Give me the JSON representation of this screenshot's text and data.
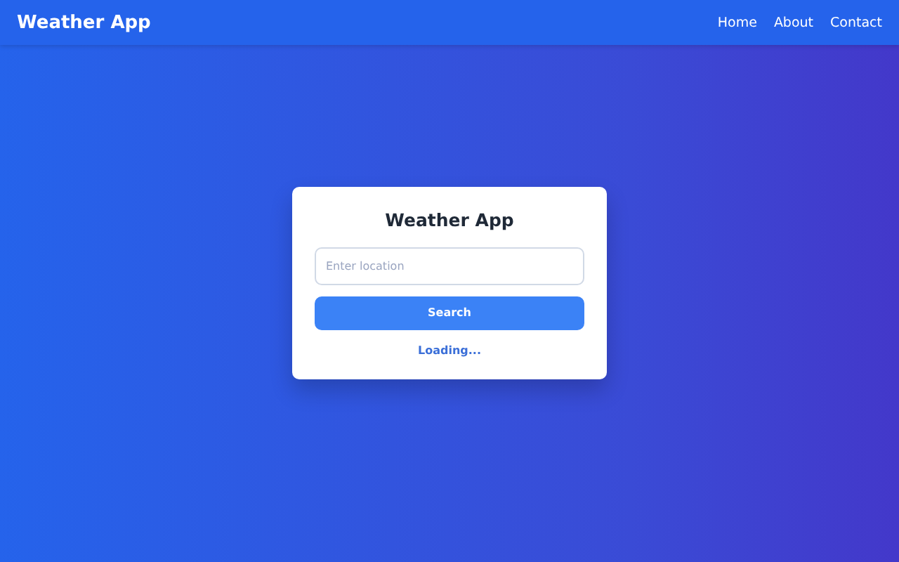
{
  "navbar": {
    "brand": "Weather App",
    "links": [
      {
        "label": "Home"
      },
      {
        "label": "About"
      },
      {
        "label": "Contact"
      }
    ]
  },
  "card": {
    "title": "Weather App",
    "search": {
      "placeholder": "Enter location"
    },
    "button": "Search",
    "status": "Loading..."
  }
}
